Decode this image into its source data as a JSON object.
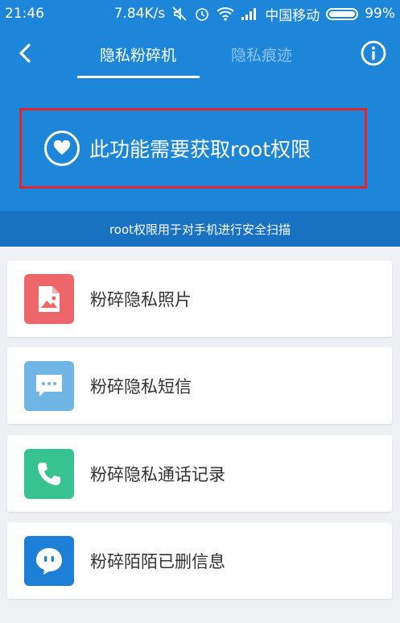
{
  "status_bar": {
    "time": "21:46",
    "speed": "7.84K/s",
    "carrier": "中国移动",
    "battery": "99%"
  },
  "header": {
    "tabs": [
      {
        "label": "隐私粉碎机",
        "active": true
      },
      {
        "label": "隐私痕迹",
        "active": false
      }
    ]
  },
  "banner": {
    "text": "此功能需要获取root权限"
  },
  "subtitle": "root权限用于对手机进行安全扫描",
  "items": [
    {
      "label": "粉碎隐私照片",
      "icon": "photo-icon",
      "color": "#ed6669"
    },
    {
      "label": "粉碎隐私短信",
      "icon": "message-icon",
      "color": "#6fb5e5"
    },
    {
      "label": "粉碎隐私通话记录",
      "icon": "phone-icon",
      "color": "#37c291"
    },
    {
      "label": "粉碎陌陌已删信息",
      "icon": "momo-icon",
      "color": "#1e7fd6"
    }
  ],
  "colors": {
    "primary": "#1e86d8",
    "subbar": "#1872c1",
    "highlight_border": "#e0262a"
  }
}
